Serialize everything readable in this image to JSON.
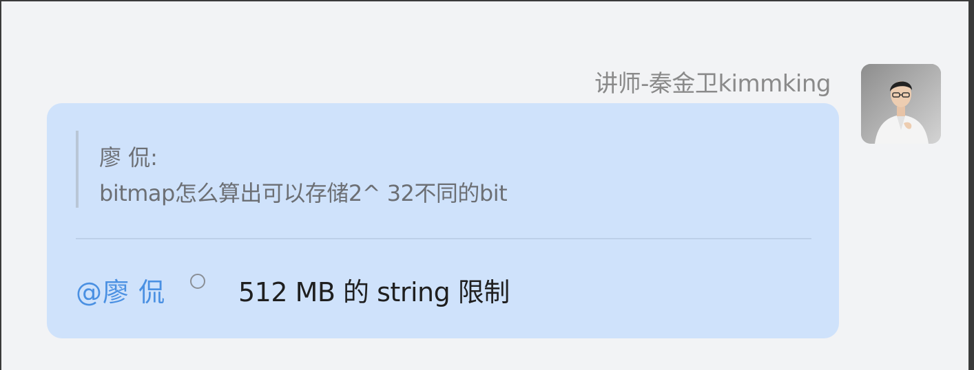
{
  "message": {
    "sender_name": "讲师-秦金卫kimmking",
    "avatar": "avatar-photo",
    "quote": {
      "author": "廖 侃:",
      "text": "bitmap怎么算出可以存储2^ 32不同的bit"
    },
    "reply": {
      "mention": "@廖 侃",
      "text": "512 MB 的 string 限制"
    }
  },
  "colors": {
    "bubble": "#cfe2fb",
    "mention": "#4a90e2",
    "sender": "#8a8a8a"
  }
}
